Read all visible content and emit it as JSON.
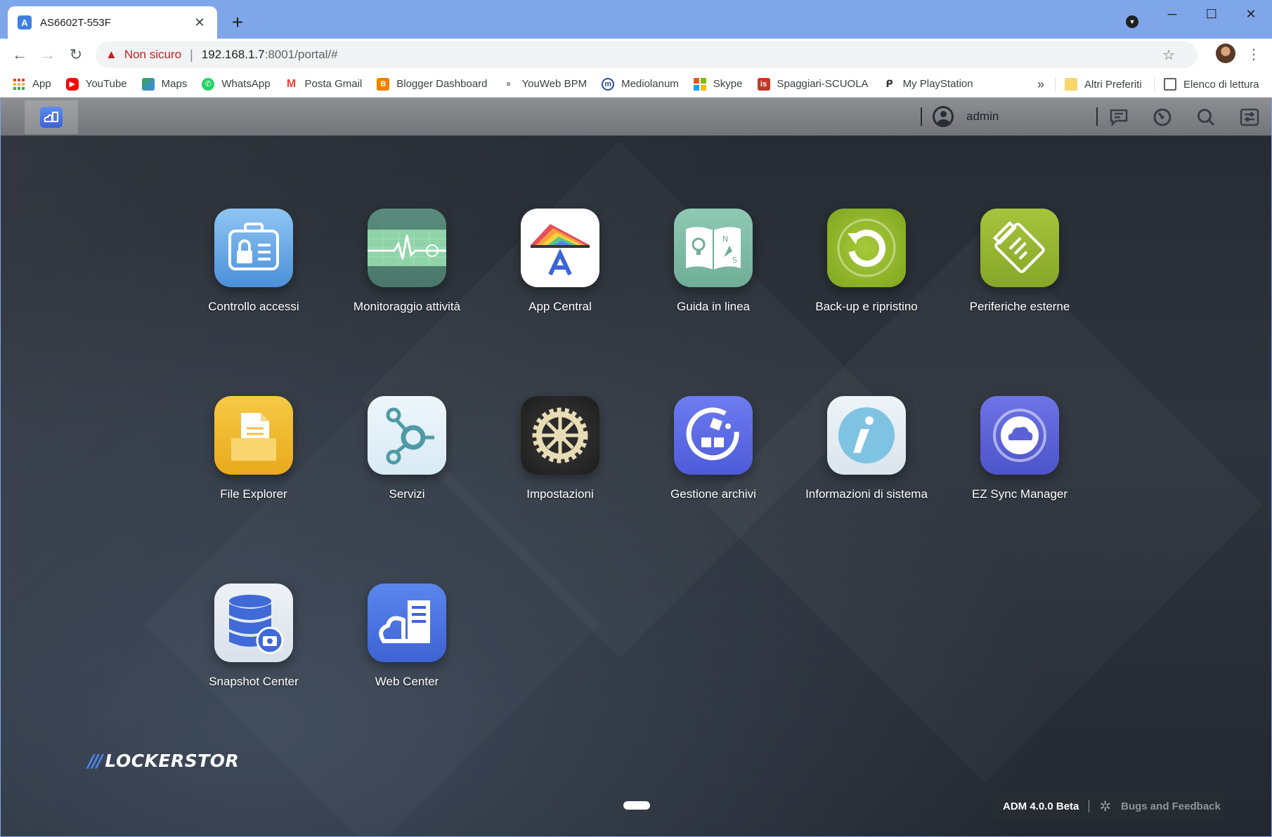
{
  "browser": {
    "tab_title": "AS6602T-553F",
    "tab_favicon": "A",
    "new_tab_symbol": "+",
    "window_controls": [
      "─",
      "☐",
      "✕"
    ],
    "address": {
      "security_label": "Non sicuro",
      "url_host": "192.168.1.7",
      "url_path": ":8001/portal/#"
    },
    "bookmarks": [
      {
        "label": "App",
        "icon": "apps-grid-icon",
        "color": "#ea4335"
      },
      {
        "label": "YouTube",
        "icon": "youtube-icon",
        "color": "#ff0000"
      },
      {
        "label": "Maps",
        "icon": "maps-icon",
        "color": "#34a853"
      },
      {
        "label": "WhatsApp",
        "icon": "whatsapp-icon",
        "color": "#25d366"
      },
      {
        "label": "Posta Gmail",
        "icon": "gmail-icon",
        "color": "#ea4335"
      },
      {
        "label": "Blogger Dashboard",
        "icon": "blogger-icon",
        "color": "#f57d00"
      },
      {
        "label": "YouWeb BPM",
        "icon": "bpm-icon",
        "color": "#555555"
      },
      {
        "label": "Mediolanum",
        "icon": "mediolanum-icon",
        "color": "#2d4e9c"
      },
      {
        "label": "Skype",
        "icon": "skype-icon",
        "color": "#00a4ef"
      },
      {
        "label": "Spaggiari-SCUOLA",
        "icon": "spaggiari-icon",
        "color": "#c0392b"
      },
      {
        "label": "My PlayStation",
        "icon": "playstation-icon",
        "color": "#333333"
      }
    ],
    "bookmarks_overflow": "»",
    "other_bookmarks": "Altri Preferiti",
    "reading_list": "Elenco di lettura"
  },
  "portal": {
    "user": "admin",
    "apps": [
      {
        "label": "Controllo accessi",
        "icon": "access-control-icon"
      },
      {
        "label": "Monitoraggio attività",
        "icon": "activity-monitor-icon"
      },
      {
        "label": "App Central",
        "icon": "app-central-icon"
      },
      {
        "label": "Guida in linea",
        "icon": "online-help-icon"
      },
      {
        "label": "Back-up e ripristino",
        "icon": "backup-restore-icon"
      },
      {
        "label": "Periferiche esterne",
        "icon": "external-devices-icon"
      },
      {
        "label": "File Explorer",
        "icon": "file-explorer-icon"
      },
      {
        "label": "Servizi",
        "icon": "services-icon"
      },
      {
        "label": "Impostazioni",
        "icon": "settings-icon"
      },
      {
        "label": "Gestione archivi",
        "icon": "storage-manager-icon"
      },
      {
        "label": "Informazioni di sistema",
        "icon": "system-info-icon"
      },
      {
        "label": "EZ Sync Manager",
        "icon": "ez-sync-icon"
      },
      {
        "label": "Snapshot Center",
        "icon": "snapshot-center-icon"
      },
      {
        "label": "Web Center",
        "icon": "web-center-icon"
      }
    ],
    "logo": "LOCKERSTOR",
    "version": "ADM 4.0.0 Beta",
    "feedback": "Bugs and Feedback"
  },
  "colors": {
    "chrome_frame": "#7fa6e8",
    "insecure_red": "#c5221f",
    "accent_blue": "#4f86f0",
    "portal_bg": "#2a2f37"
  }
}
